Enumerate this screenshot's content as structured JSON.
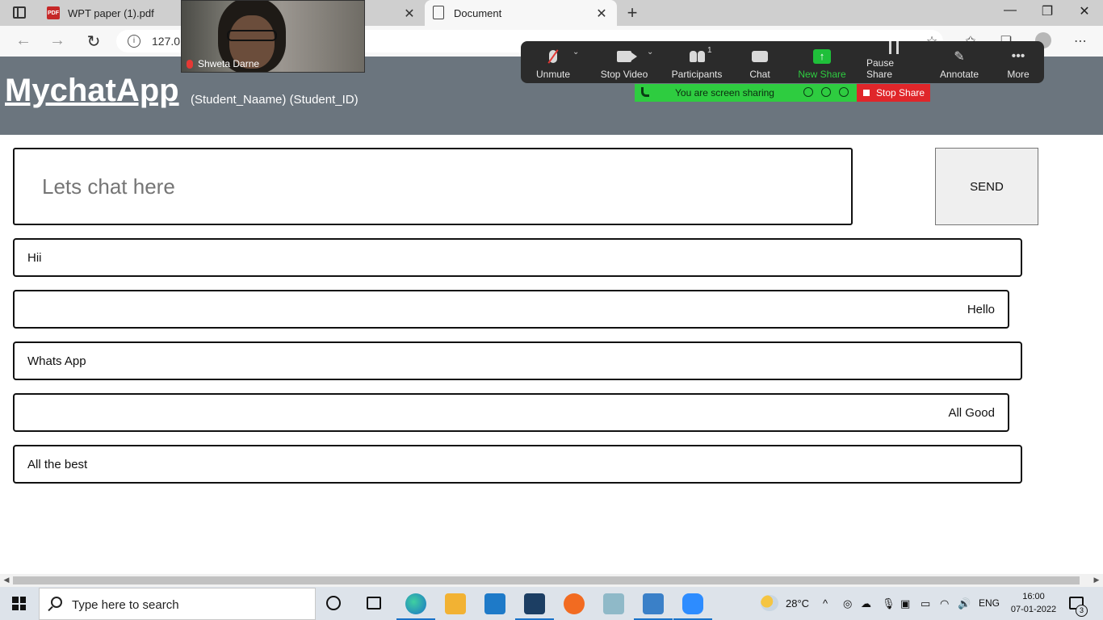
{
  "browser": {
    "tabs": [
      {
        "label": "WPT paper (1).pdf",
        "icon": "pdf-icon"
      },
      {
        "label": "Document",
        "icon": "document-icon"
      }
    ],
    "url": "127.0."
  },
  "zoom": {
    "participant_name": "Shweta Darne",
    "toolbar": {
      "unmute": "Unmute",
      "stop_video": "Stop Video",
      "participants": "Participants",
      "participants_count": "1",
      "chat": "Chat",
      "new_share": "New Share",
      "pause_share": "Pause Share",
      "annotate": "Annotate",
      "more": "More"
    },
    "sharing_banner": "You are screen sharing",
    "stop_share": "Stop Share",
    "colors": {
      "green": "#2ecc40",
      "red": "#e0262a",
      "toolbar_bg": "#2b2b2b"
    }
  },
  "page": {
    "brand": "MychatApp",
    "student": "(Student_Naame) (Student_ID)",
    "chat_placeholder": "Lets chat here",
    "send_label": "SEND",
    "messages": [
      {
        "text": "Hii",
        "side": "left"
      },
      {
        "text": "Hello",
        "side": "right"
      },
      {
        "text": "Whats App",
        "side": "left"
      },
      {
        "text": "All Good",
        "side": "right"
      },
      {
        "text": "All the best",
        "side": "left"
      }
    ],
    "colors": {
      "header_bg": "#6b757e"
    }
  },
  "taskbar": {
    "search_placeholder": "Type here to search",
    "weather": "28°C",
    "language": "ENG",
    "time": "16:00",
    "date": "07-01-2022",
    "notifications": "3"
  }
}
